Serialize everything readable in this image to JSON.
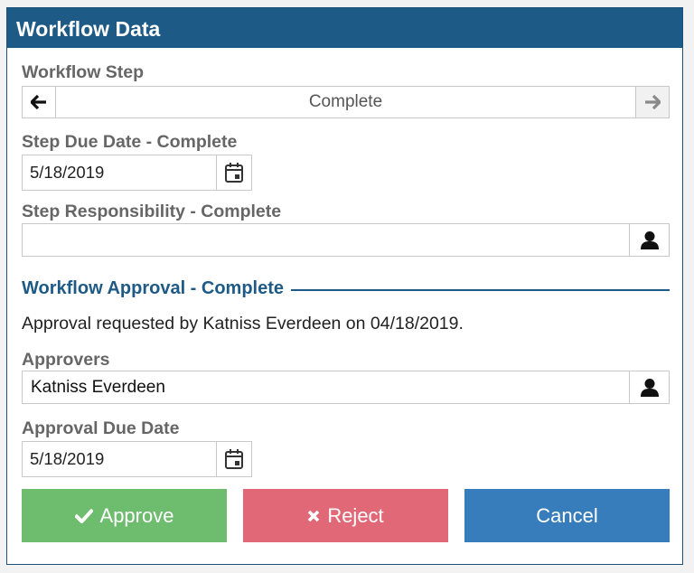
{
  "panel": {
    "title": "Workflow Data"
  },
  "workflow_step": {
    "label": "Workflow Step",
    "value": "Complete",
    "prev_icon": "arrow-left-icon",
    "next_icon": "arrow-right-icon"
  },
  "step_due_date": {
    "label": "Step Due Date - Complete",
    "value": "5/18/2019",
    "icon": "calendar-icon"
  },
  "step_responsibility": {
    "label": "Step Responsibility - Complete",
    "value": "",
    "icon": "person-icon"
  },
  "approval_section": {
    "title": "Workflow Approval - Complete",
    "info": "Approval requested by Katniss Everdeen on 04/18/2019."
  },
  "approvers": {
    "label": "Approvers",
    "value": "Katniss Everdeen",
    "icon": "person-icon"
  },
  "approval_due_date": {
    "label": "Approval Due Date",
    "value": "5/18/2019",
    "icon": "calendar-icon"
  },
  "actions": {
    "approve": "Approve",
    "reject": "Reject",
    "cancel": "Cancel"
  },
  "colors": {
    "header": "#1e5a86",
    "approve": "#6ebd6f",
    "reject": "#e06877",
    "cancel": "#377dbb"
  }
}
